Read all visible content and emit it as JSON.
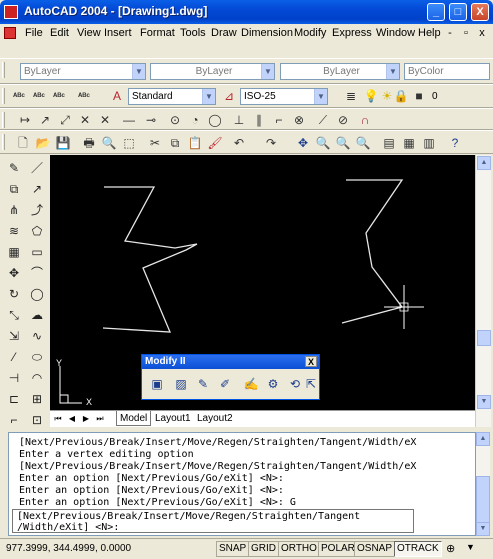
{
  "window": {
    "title": "AutoCAD 2004 - [Drawing1.dwg]",
    "buttons": {
      "minimize": "_",
      "maximize": "□",
      "close": "X"
    }
  },
  "menubar": {
    "items": [
      "File",
      "Edit",
      "View",
      "Insert",
      "Format",
      "Tools",
      "Draw",
      "Dimension",
      "Modify",
      "Express",
      "Window",
      "Help"
    ],
    "mdi_buttons": {
      "minimize": "-",
      "restore": "▫",
      "close": "x"
    }
  },
  "properties": {
    "layer_combo": "ByLayer",
    "linetype_combo": "ByLayer",
    "lineweight_combo": "ByLayer",
    "color_combo": "ByColor"
  },
  "styles": {
    "text_style": "Standard",
    "dim_style": "ISO-25",
    "layer_value": "0"
  },
  "layout_tabs": [
    "Model",
    "Layout1",
    "Layout2"
  ],
  "modify2": {
    "title": "Modify II",
    "close": "X"
  },
  "ucs": {
    "x_label": "X",
    "y_label": "Y"
  },
  "command_history": [
    "[Next/Previous/Break/Insert/Move/Regen/Straighten/Tangent/Width/eX",
    "Enter a vertex editing option",
    "[Next/Previous/Break/Insert/Move/Regen/Straighten/Tangent/Width/eX",
    "Enter an option [Next/Previous/Go/eXit] <N>:",
    "Enter an option [Next/Previous/Go/eXit] <N>:",
    "Enter an option [Next/Previous/Go/eXit] <N>: G"
  ],
  "command_prompt": [
    "[Next/Previous/Break/Insert/Move/Regen/Straighten/Tangent",
    "/Width/eXit] <N>:"
  ],
  "statusbar": {
    "coordinates": "977.3999, 344.4999, 0.0000",
    "buttons": [
      "SNAP",
      "GRID",
      "ORTHO",
      "POLAR",
      "OSNAP",
      "OTRACK"
    ]
  }
}
